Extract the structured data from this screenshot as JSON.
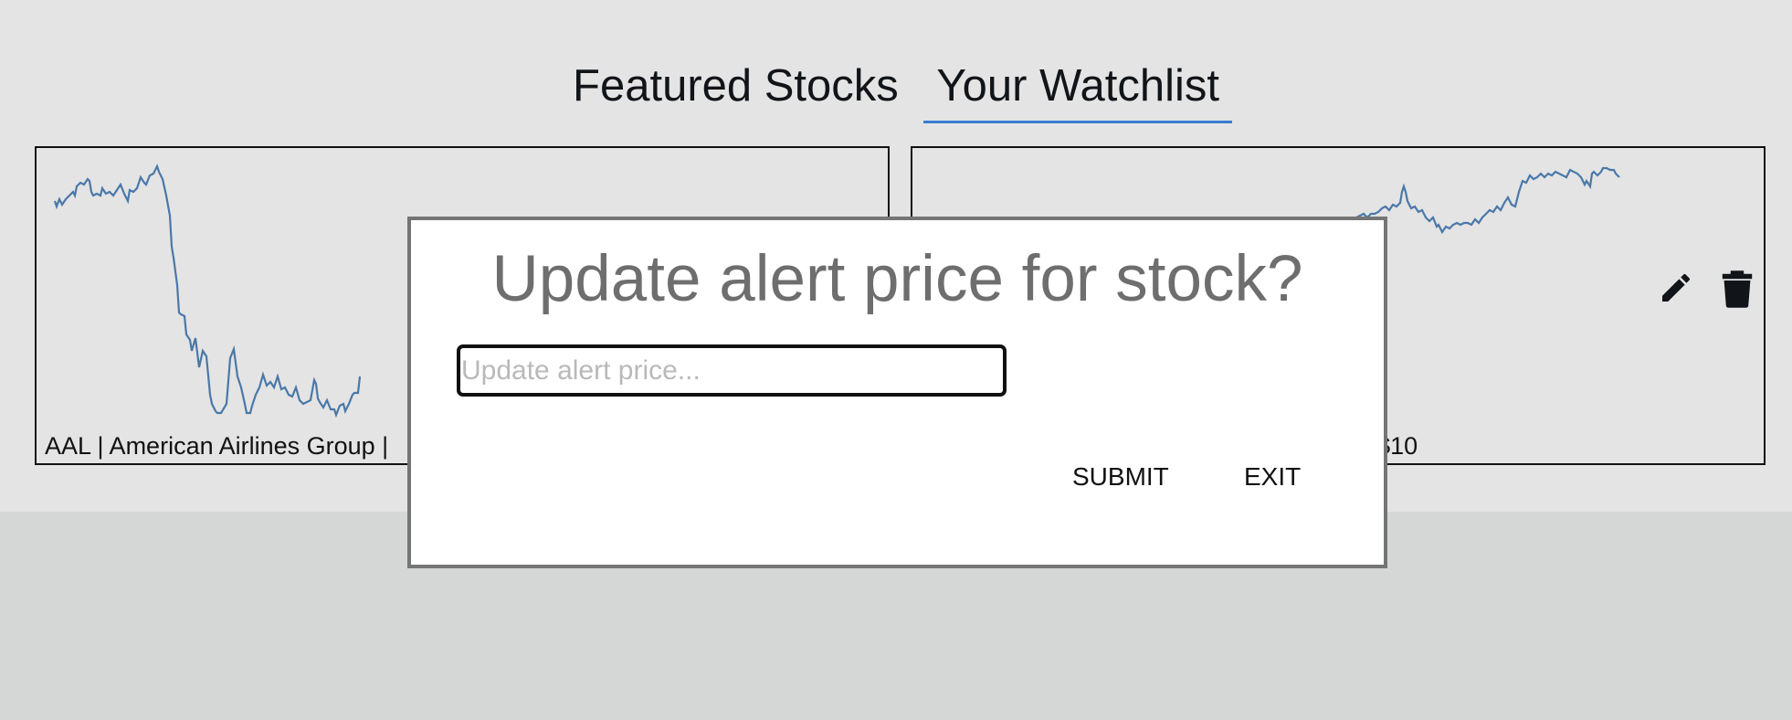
{
  "tabs": [
    {
      "label": "Featured Stocks",
      "active": false
    },
    {
      "label": "Your Watchlist",
      "active": true
    }
  ],
  "cards": [
    {
      "caption": "AAL | American Airlines Group |",
      "line_color": "#4a78a8"
    },
    {
      "caption": "e below: $10",
      "line_color": "#4a78a8"
    }
  ],
  "icons": {
    "edit": "pencil-icon",
    "delete": "trash-icon"
  },
  "modal": {
    "title": "Update alert price for stock?",
    "input": {
      "placeholder": "Update alert price...",
      "value": ""
    },
    "submit_label": "SUBMIT",
    "exit_label": "EXIT"
  },
  "colors": {
    "tab_underline": "#3a7dd2",
    "chart_line": "#4a78a8",
    "modal_border": "#757575",
    "title": "#6e6e6e"
  }
}
